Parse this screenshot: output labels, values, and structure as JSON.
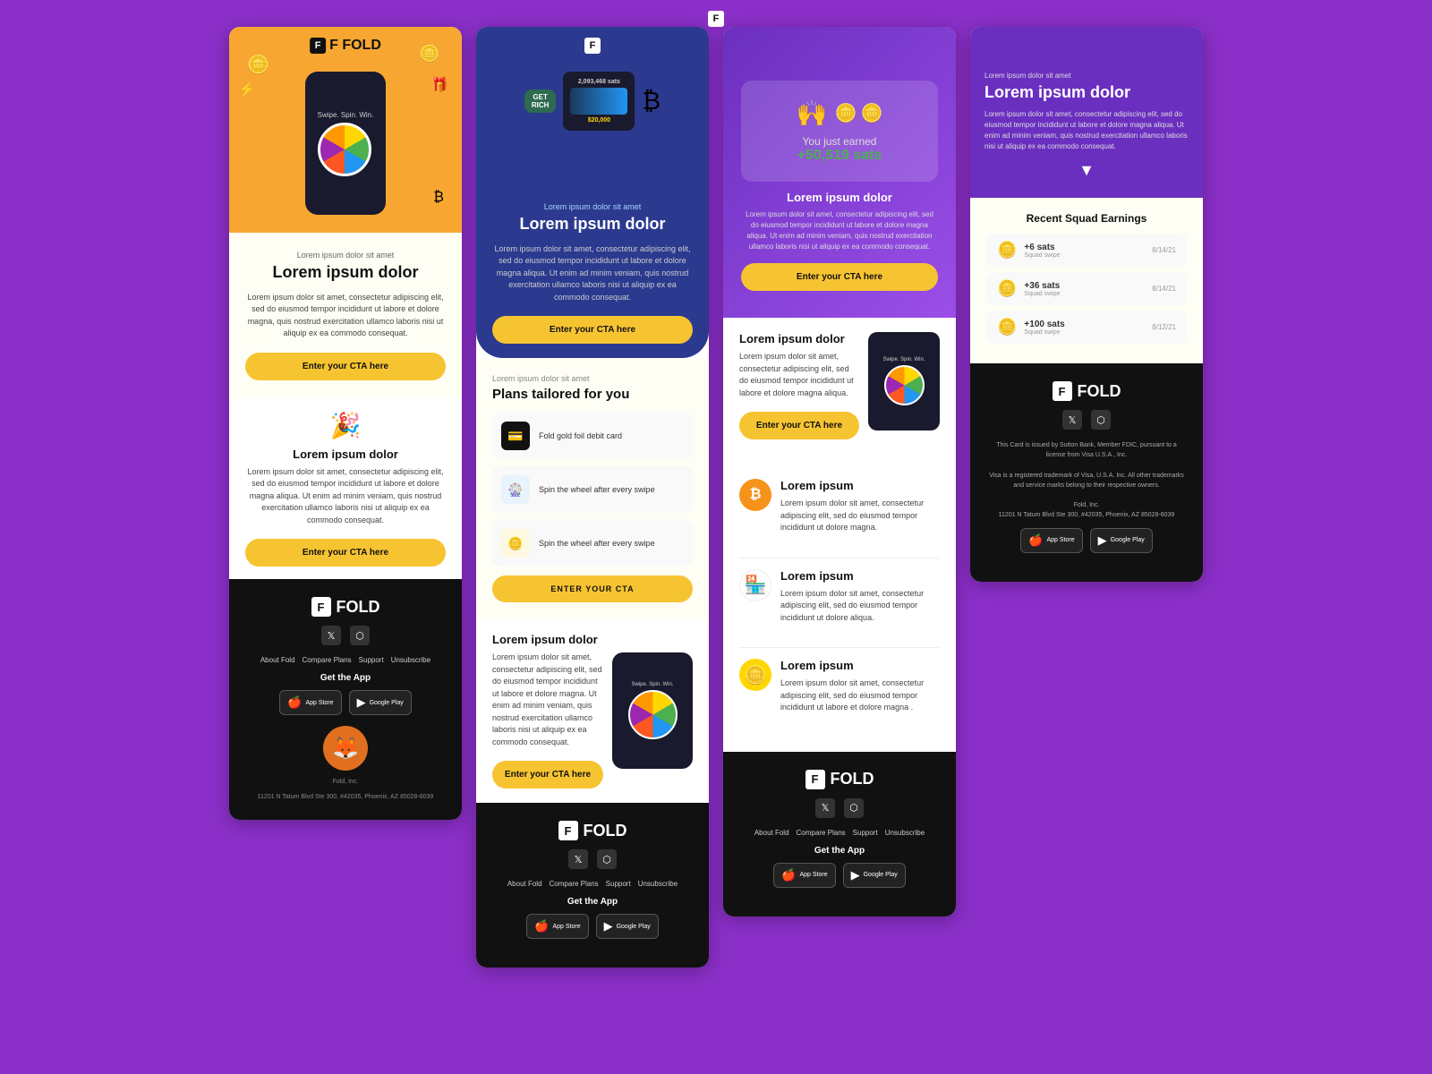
{
  "bg_color": "#8B2FC9",
  "cards": [
    {
      "id": "card1",
      "logo": "F FOLD",
      "hero_bg": "#F7A731",
      "eyebrow": "Lorem ipsum dolor sit amet",
      "headline": "Lorem ipsum dolor",
      "body_text": "Lorem ipsum dolor sit amet, consectetur adipiscing elit, sed do eiusmod tempor incididunt ut labore et dolore magna, quis nostrud exercitation ullamco laboris nisi ut aliquip ex ea commodo consequat.",
      "cta": "Enter your CTA here",
      "feature2_eyebrow": "",
      "feature2_title": "Lorem ipsum dolor",
      "feature2_text": "Lorem ipsum dolor sit amet, consectetur adipiscing elit, sed do eiusmod tempor incididunt ut labore et dolore magna aliqua. Ut enim ad minim veniam, quis nostrud exercitation ullamco laboris nisi ut aliquip ex ea commodo consequat.",
      "cta2": "Enter your CTA here",
      "footer": {
        "brand": "FOLD",
        "links": [
          "About Fold",
          "Compare Plans",
          "Support",
          "Unsubscribe"
        ],
        "get_app": "Get the App",
        "app_store": "App Store",
        "google_play": "Google Play",
        "company": "Fold, Inc.",
        "address": "11201 N Tatum Blvd Ste 300, #42035, Phoenix, AZ 85028-6039"
      }
    },
    {
      "id": "card2",
      "logo": "F",
      "hero_bg": "#2B3A8F",
      "eyebrow": "Lorem ipsum dolor sit amet",
      "headline": "Lorem ipsum dolor",
      "body_text": "Lorem ipsum dolor sit amet, consectetur adipiscing elit, sed do eiusmod tempor incididunt ut labore et dolore magna aliqua. Ut enim ad minim veniam, quis nostrud exercitation ullamco laboris nisi ut aliquip ex ea commodo consequat.",
      "cta": "Enter your CTA here",
      "plans_eyebrow": "Lorem ipsum dolor sit amet",
      "plans_title": "Plans tailored for you",
      "plans": [
        {
          "icon": "💳",
          "text": "Fold gold foil debit card"
        },
        {
          "icon": "🎡",
          "text": "Spin the wheel after every swipe"
        },
        {
          "icon": "🪙",
          "text": "Spin the wheel after every swipe"
        }
      ],
      "plans_cta": "ENTER YOUR CTA",
      "spin_eyebrow": "Lorem ipsum dolor",
      "spin_text": "Lorem ipsum dolor sit amet, consectetur adipiscing elit, sed do eiusmod tempor incididunt ut labore et dolore magna. Ut enim ad minim veniam, quis nostrud exercitation ullamco laboris nisi ut aliquip ex ea commodo consequat.",
      "spin_cta": "Enter your CTA here",
      "footer": {
        "brand": "FOLD",
        "links": [
          "About Fold",
          "Compare Plans",
          "Support",
          "Unsubscribe"
        ],
        "get_app": "Get the App"
      }
    },
    {
      "id": "card3",
      "logo": "F",
      "hero_bg": "#7B3FD0",
      "earned_label": "You just earned",
      "earned_amount": "+50,519 sats",
      "hero_headline": "Lorem ipsum dolor",
      "hero_text": "Lorem ipsum dolor sit amet, consectetur adipiscing elit, sed do eiusmod tempor incididunt ut labore et dolore magna aliqua. Ut enim ad minim veniam, quis nostrud exercitation ullamco laboris nisi ut aliquip ex ea commodo consequat.",
      "hero_cta": "Enter your CTA here",
      "section2_headline": "Lorem ipsum dolor",
      "section2_text": "Lorem ipsum dolor sit amet, consectetur adipiscing elit, sed do eiusmod tempor incididunt ut labore et dolore magna aliqua.",
      "section2_cta": "Enter your CTA here",
      "features": [
        {
          "icon": "₿",
          "type": "bitcoin",
          "title": "Lorem ipsum",
          "text": "Lorem ipsum dolor sit amet, consectetur adipiscing elit, sed do eiusmod tempor incididunt ut dolore magna."
        },
        {
          "icon": "🏪",
          "type": "store",
          "title": "Lorem ipsum",
          "text": "Lorem ipsum dolor sit amet, consectetur adipiscing elit, sed do eiusmod tempor incididunt ut dolore aliqua."
        },
        {
          "icon": "🪙",
          "type": "coins",
          "title": "Lorem ipsum",
          "text": "Lorem ipsum dolor sit amet, consectetur adipiscing elit, sed do eiusmod tempor incididunt ut labore et dolore magna ."
        }
      ],
      "footer": {
        "brand": "FOLD",
        "links": [
          "About Fold",
          "Compare Plans",
          "Support",
          "Unsubscribe"
        ],
        "get_app": "Get the App",
        "app_store": "App Store",
        "google_play": "Google Play"
      }
    },
    {
      "id": "card4",
      "logo": "F",
      "hero_bg": "#6B2FC0",
      "hero_eyebrow": "Lorem ipsum dolor sit amet",
      "hero_title": "Lorem ipsum dolor",
      "hero_text": "Lorem ipsum dolor sit amet, consectetur adipiscing elit, sed do eiusmod tempor incididunt ut labore et dolore magna aliqua. Ut enim ad minim veniam, quis nostrud exercitation ullamco laboris nisi ut aliquip ex ea commodo consequat.",
      "squad_title": "Recent Squad Earnings",
      "squad_items": [
        {
          "icon": "🪙",
          "amount": "+6 sats",
          "sublabel": "Squad swipe",
          "date": "8/14/21"
        },
        {
          "icon": "🪙",
          "amount": "+36 sats",
          "sublabel": "Squad swipe",
          "date": "8/14/21"
        },
        {
          "icon": "🪙",
          "amount": "+100 sats",
          "sublabel": "Squad swipe",
          "date": "8/12/21"
        }
      ],
      "footer": {
        "brand": "FOLD",
        "twitter": "𝕏",
        "discord": "⬡",
        "legal1": "This Card is issued by Sutton Bank, Member FDIC, pursuant to a license from Visa U.S.A., Inc.",
        "legal2": "Visa is a registered trademark of Visa, U.S.A. Inc. All other trademarks and service marks belong to their respective owners.",
        "company": "Fold, Inc.",
        "address": "11201 N Tatum Blvd Ste 300, #42035, Phoenix, AZ 85028-6039",
        "app_store": "App Store",
        "google_play": "Google Play"
      }
    }
  ]
}
